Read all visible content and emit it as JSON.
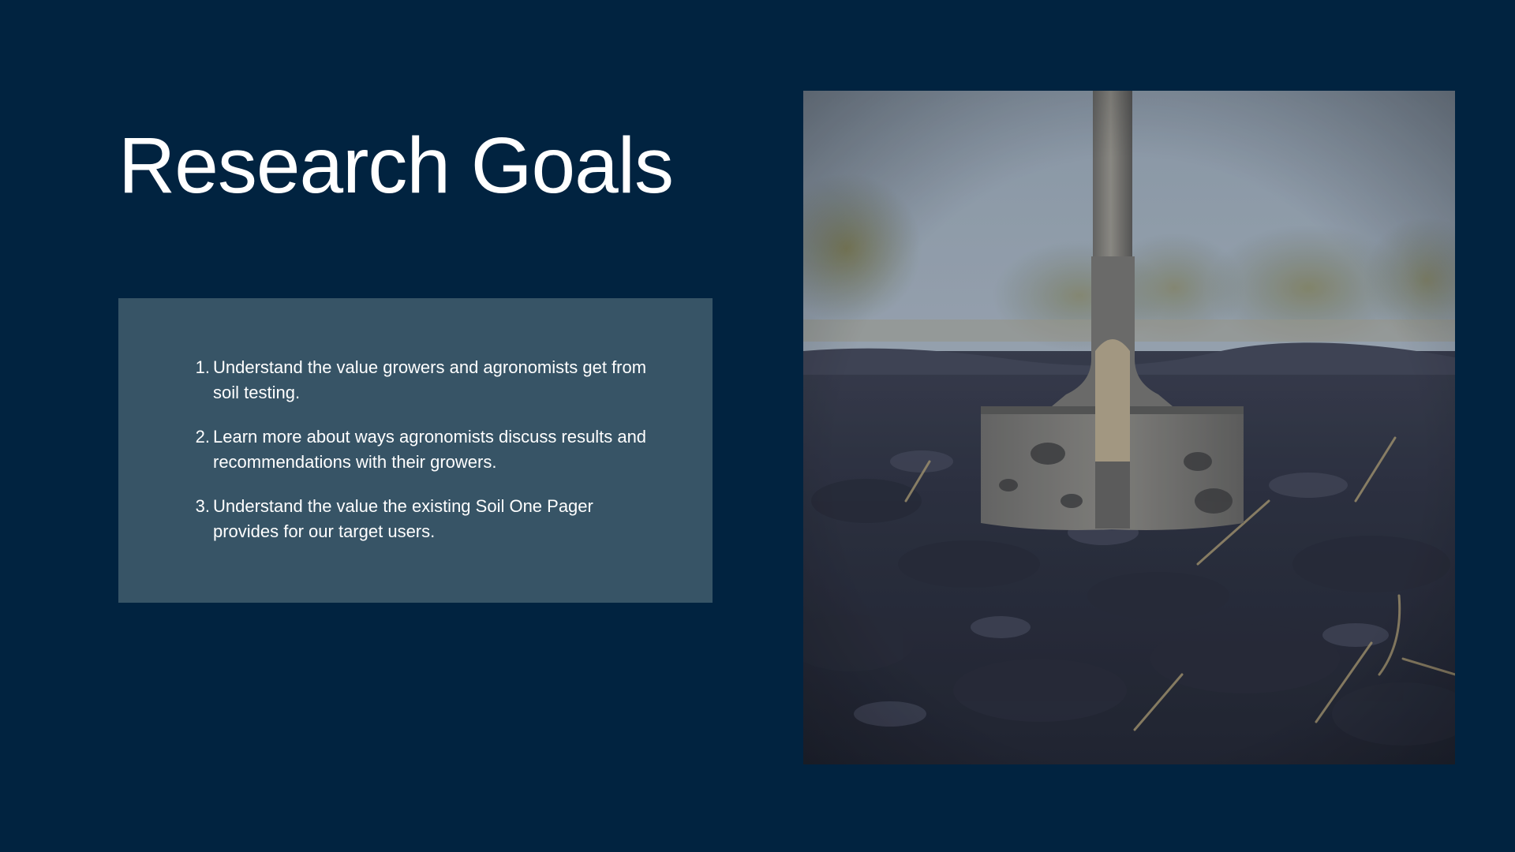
{
  "slide": {
    "title": "Research Goals",
    "goals": [
      {
        "number": "1.",
        "text": "Understand the value growers and agronomists get from soil testing."
      },
      {
        "number": "2.",
        "text": "Learn more about ways agronomists discuss results and recommendations with their growers."
      },
      {
        "number": "3.",
        "text": "Understand the value the existing Soil One Pager provides for our target users."
      }
    ],
    "image": {
      "subject": "shovel-in-soil-photo"
    }
  },
  "colors": {
    "background": "#012340",
    "goals_box": "#375466",
    "text": "#ffffff"
  }
}
